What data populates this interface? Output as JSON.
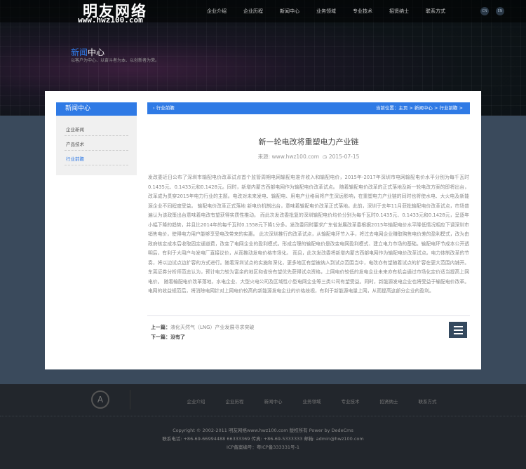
{
  "header": {
    "logo": "明友网络",
    "logo_url": "www.hwz100.com",
    "nav": [
      "企业介绍",
      "企业历程",
      "新闻中心",
      "业务领域",
      "专业技术",
      "招贤纳士",
      "联系方式"
    ],
    "lang": [
      "CN",
      "EN"
    ]
  },
  "banner": {
    "title_hl": "新闻",
    "title_rest": "中心",
    "subtitle": "以客户为中心、以奋斗者为本、以创新者为荣。"
  },
  "sidebar": {
    "title": "新闻中心",
    "items": [
      "企业新闻",
      "产品技术",
      "行业前瞻"
    ]
  },
  "crumb": {
    "section": "行业前瞻",
    "location": "当前位置：主页 > 新闻中心 > 行业前瞻 >"
  },
  "article": {
    "title": "新一轮电改将重塑电力产业链",
    "source": "来源: www.hwz100.com",
    "date": "2015-07-15",
    "body": "发改委近日公布了深圳市输配电价改革试点首个监管周期电网输配电准许收入和输配电价，2015年-2017年深圳市电网输配电价水平分别为每千瓦时0.1435元、0.1433元和0.1428元。同时，新增内蒙古西部电网作为输配电价改革试点。 随着输配电价改革的正式落地及新一轮电改方案的即将出台，改革成为贯穿2015年电力行业的主题。电改对未来发电、输配电、用电产业格局将产生深远影响，在重塑电力产业链的同时也将使水电、大火电及新能源企业不同程度受益。 输配电价改革正式落地 新电价机制出台，意味着输配电价改革正式落地。此前，深圳于去年11月获批输配电价改革试点，市场普遍认为该政策出台意味着电改有望获得实质性推动。 而此次发改委批复的深圳输配电价均价分别为每千瓦时0.1435元、0.1433元和0.1428元，呈逐年小幅下降的趋势，并且比2014年的每千瓦时0.1558元下降1分多。发改委同时要求广东省发展改革委根据2015年输配电价水平降低情况相应下调深圳市销售电价，使得电力用户能够享受电改带来的实惠。 此次深圳推行的改革试点，从输配电环节入手，将过去电网企业赚取购售电价差的盈利模式，改为由政府核定成本后收取固定通道费，改变了电网企业的盈利模式。形成合理的输配电价是改变电网盈利模式、建立电力市场的基础。输配电环节成本公开透明后，有利于大用户与发电厂直接议价，从而推动发电价格市场化。 而且，此次发改委将新增内蒙古西部电网作为输配电价改革试点。电力体制改革的节奏，将以边试点边扩容的方式进行。随着深圳试点的实施和深化，更多地区有望被纳入到试点范围当中，电改亦有望随着试点的扩容在更大范围内铺开。 东莞证券分析师范志认为，预计电力较为富余的地区和省份有望优先获得试点资格，上网电价较低的发电企业未来亦有机会通过市场化定价适当提高上网电价。 随着输配电价改革落地，水电企业、大型火电公司及区域性小型电网企业等三类公司有望受益。同时，新能源发电企业也将受益于输配电价改革。电网的收益规范后，将消除电网针对上网电价较高的新能源发电企业的价格歧视，有利于新能源电量上网，从而提高这部分企业的盈利。",
    "prev_label": "上一篇：",
    "prev": "液化天然气（LNG）产业发展寻求突破",
    "next_label": "下一篇：",
    "next": "没有了"
  },
  "footer": {
    "logo": "A",
    "nav": [
      "企业介绍",
      "企业历程",
      "新闻中心",
      "业务领域",
      "专业技术",
      "招贤纳士",
      "联系方式"
    ],
    "copyright": "Copyright © 2002-2011 明友网络www.hwz100.com 版权所有   Power by DedeCms",
    "contact": "联系电话: +86-69-66994488    66333369 传真: +86-69-5333333 邮箱: admin@hwz100.com",
    "icp": "ICP备案编号：粤ICP备333331号-1"
  }
}
